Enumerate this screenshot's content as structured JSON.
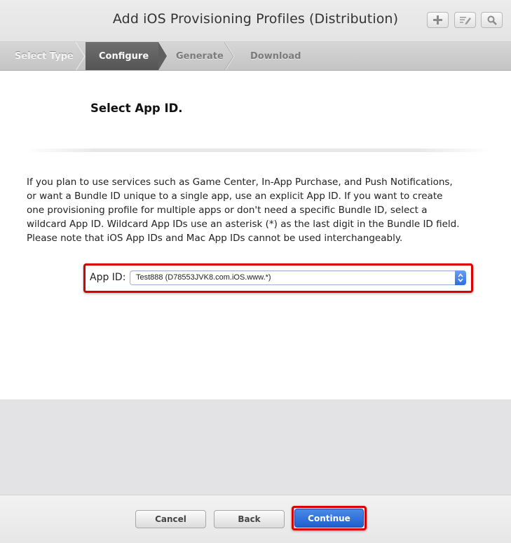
{
  "header": {
    "title": "Add iOS Provisioning Profiles (Distribution)",
    "tools": [
      {
        "name": "add-icon"
      },
      {
        "name": "edit-icon"
      },
      {
        "name": "search-icon"
      }
    ]
  },
  "steps": [
    {
      "label": "Select Type",
      "state": "done"
    },
    {
      "label": "Configure",
      "state": "active"
    },
    {
      "label": "Generate",
      "state": "inactive"
    },
    {
      "label": "Download",
      "state": "inactive"
    }
  ],
  "main": {
    "heading": "Select App ID.",
    "description": "If you plan to use services such as Game Center, In-App Purchase, and Push Notifications, or want a Bundle ID unique to a single app, use an explicit App ID. If you want to create one provisioning profile for multiple apps or don't need a specific Bundle ID, select a wildcard App ID. Wildcard App IDs use an asterisk (*) as the last digit in the Bundle ID field. Please note that iOS App IDs and Mac App IDs cannot be used interchangeably.",
    "app_id": {
      "label": "App ID:",
      "selected": "Test888 (D78553JVK8.com.iOS.www.*)"
    }
  },
  "footer": {
    "cancel_label": "Cancel",
    "back_label": "Back",
    "continue_label": "Continue"
  },
  "colors": {
    "highlight": "#d90000",
    "primary": "#2b6fe6",
    "active_step": "#5f5f5f"
  }
}
